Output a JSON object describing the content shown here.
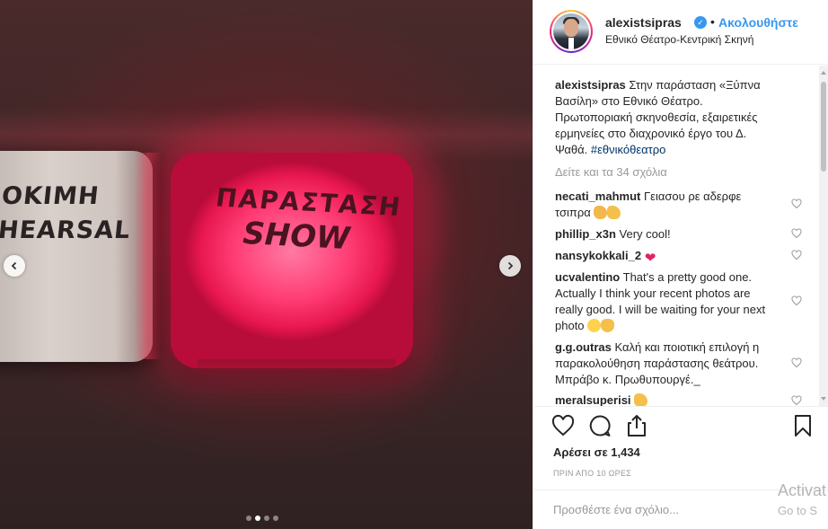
{
  "photo": {
    "sign_left_line1": "ΟΚΙΜΗ",
    "sign_left_line2": "HEARSAL",
    "sign_red_line1": "ΠΑΡΑΣΤΑΣΗ",
    "sign_red_line2": "SHOW",
    "carousel_dots": 4,
    "carousel_active": 2
  },
  "header": {
    "username": "alexistsipras",
    "separator": "•",
    "follow_label": "Ακολουθήστε",
    "location": "Εθνικό Θέατρο-Κεντρική Σκηνή"
  },
  "caption": {
    "username": "alexistsipras",
    "text": "Στην παράσταση «Ξύπνα Βασίλη» στο Εθνικό Θέατρο. Πρωτοποριακή σκηνοθεσία, εξαιρετικές ερμηνείες στο διαχρονικό έργο του Δ. Ψαθά.",
    "hashtag": "#εθνικόθεατρο"
  },
  "view_all_comments": "Δείτε και τα 34 σχόλια",
  "comments": [
    {
      "user": "necati_mahmut",
      "text": "Γειασου ρε αδερφε τσιπρα"
    },
    {
      "user": "phillip_x3n",
      "text": "Very cool!"
    },
    {
      "user": "nansykokkali_2",
      "text": ""
    },
    {
      "user": "ucvalentino",
      "text": "That's a pretty good one. Actually I think your recent photos are really good. I will be waiting for your next photo"
    },
    {
      "user": "g.g.outras",
      "text": "Καλή και ποιοτική επιλογή η παρακολούθηση παράστασης θεάτρου. Μπράβο κ. Πρωθυπουργέ._"
    },
    {
      "user": "meralsuperisi",
      "text": ""
    }
  ],
  "likes": "Αρέσει σε 1,434",
  "time": "ΠΡΙΝ ΑΠΟ 10 ΩΡΕΣ",
  "add_comment_placeholder": "Προσθέστε ένα σχόλιο...",
  "watermark": {
    "line1": "Activat",
    "line2": "Go to S"
  },
  "colors": {
    "link": "#3897f0",
    "sign": "#ff3b73",
    "text": "#262626",
    "muted": "#999999"
  }
}
